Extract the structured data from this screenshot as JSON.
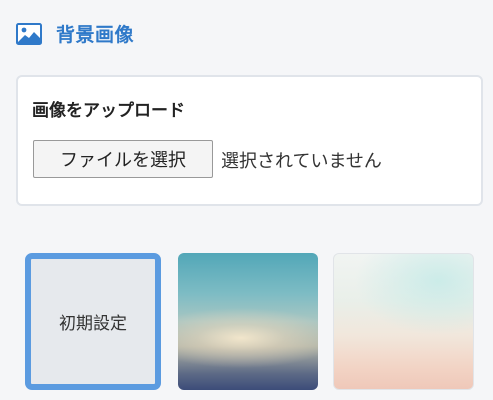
{
  "section": {
    "icon": "image-icon",
    "title": "背景画像"
  },
  "upload": {
    "title": "画像をアップロード",
    "button_label": "ファイルを選択",
    "status": "選択されていません"
  },
  "thumbnails": {
    "default_label": "初期設定",
    "selected": "初期設定"
  },
  "colors": {
    "accent": "#2f79c9",
    "selected_border": "#5b9be0"
  }
}
